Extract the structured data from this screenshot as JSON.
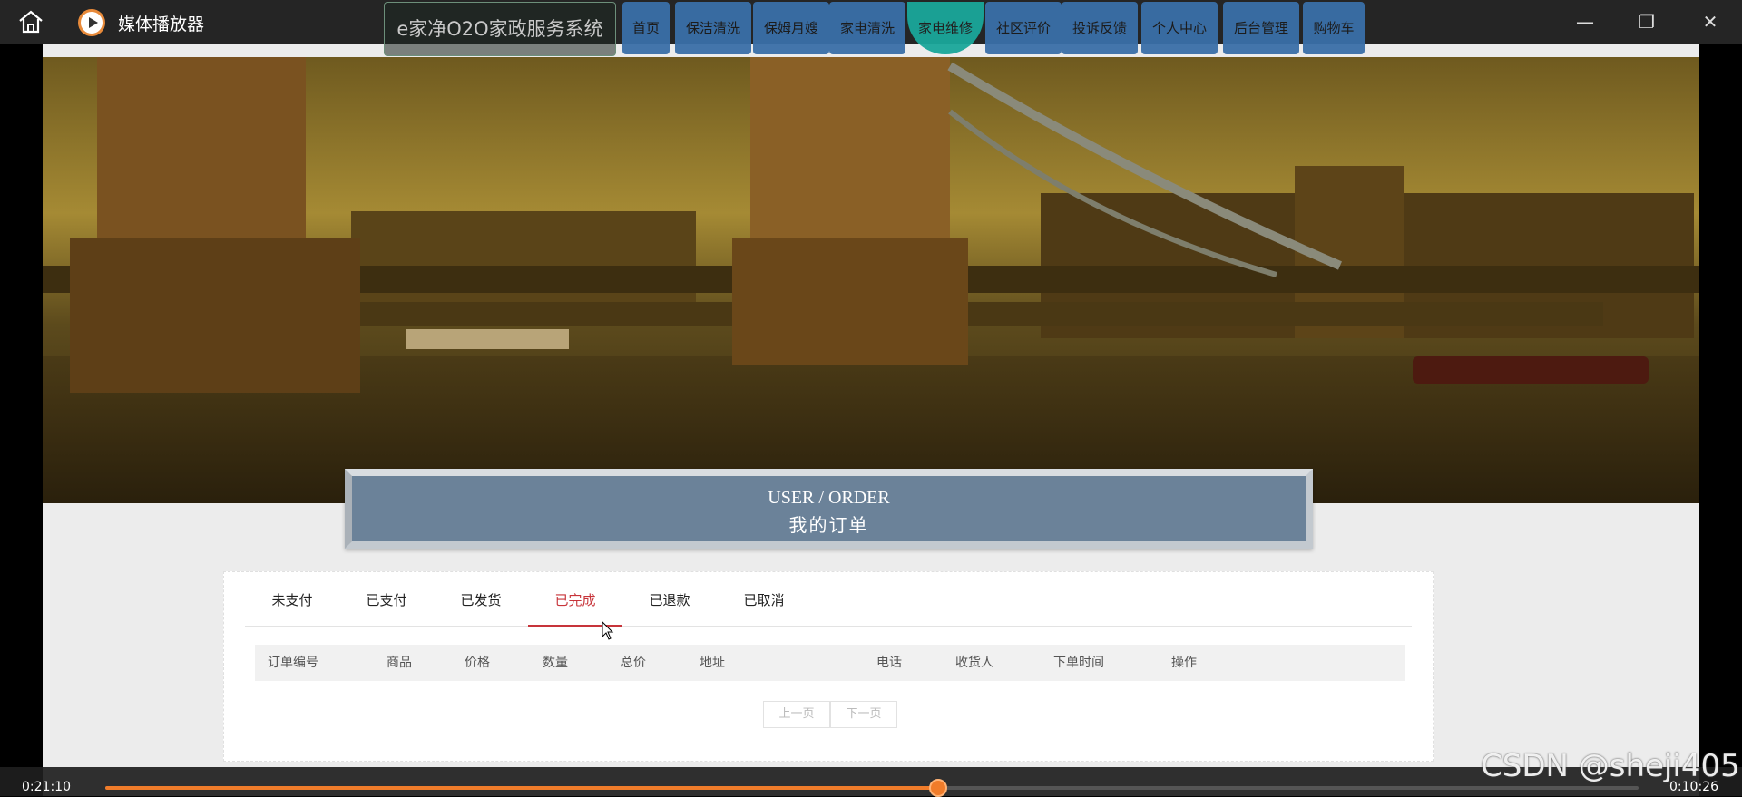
{
  "player": {
    "title": "媒体播放器",
    "current_time": "0:21:10",
    "remaining_time": "0:10:26",
    "progress": 0.543,
    "accent_color": "#f07c2a"
  },
  "site": {
    "logo_text": "e家净O2O家政服务系统",
    "nav": [
      {
        "label": "首页",
        "icon": null
      },
      {
        "label": "保洁清洗"
      },
      {
        "label": "保姆月嫂"
      },
      {
        "label": "家电清洗"
      },
      {
        "label": "家电维修"
      },
      {
        "label": "社区评价"
      },
      {
        "label": "投诉反馈"
      },
      {
        "label": "个人中心"
      },
      {
        "label": "后台管理"
      },
      {
        "label": "购物车"
      }
    ],
    "active_nav_index": 4,
    "slider_count": 3,
    "slider_active": 2,
    "section": {
      "title_en": "USER / ORDER",
      "title_cn": "我的订单"
    },
    "tabs": [
      "未支付",
      "已支付",
      "已发货",
      "已完成",
      "已退款",
      "已取消"
    ],
    "active_tab": "已完成",
    "table_headers": [
      "订单编号",
      "商品",
      "价格",
      "数量",
      "总价",
      "地址",
      "电话",
      "收货人",
      "下单时间",
      "操作"
    ],
    "pager": {
      "prev": "上一页",
      "next": "下一页"
    },
    "brand_color": "#3a6fa8",
    "active_color": "#c7343a"
  },
  "watermark": "CSDN @sheji405"
}
